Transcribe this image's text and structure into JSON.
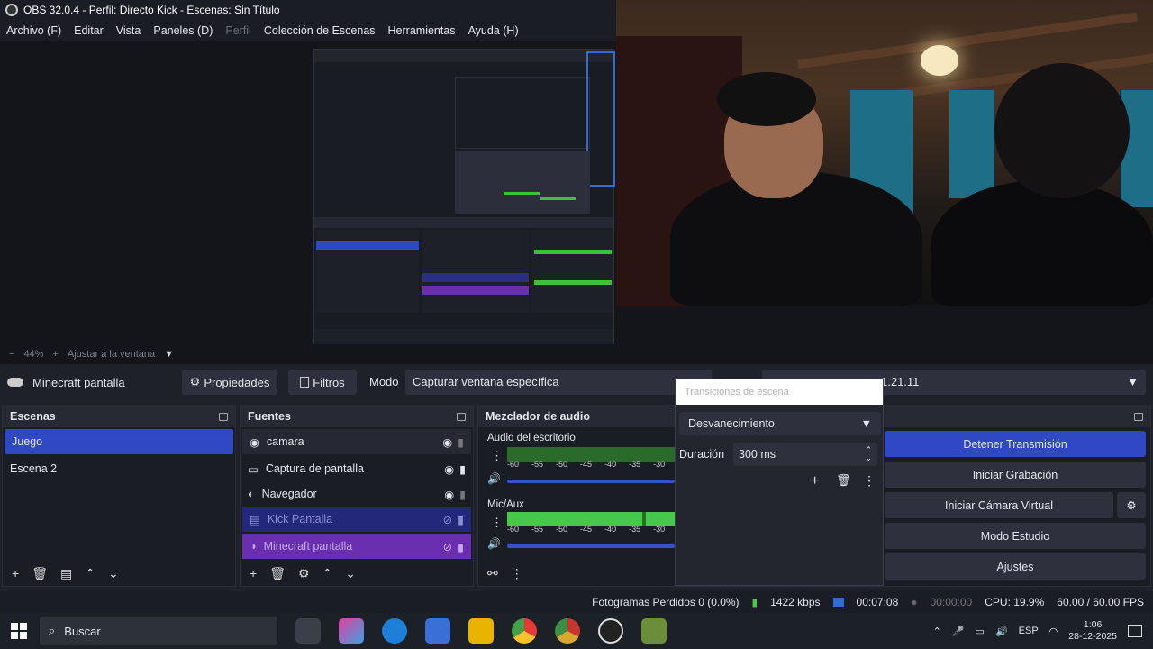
{
  "window": {
    "title": "OBS 32.0.4 - Perfil: Directo Kick - Escenas: Sin Título"
  },
  "menu": {
    "items": [
      "Archivo (F)",
      "Editar",
      "Vista",
      "Paneles (D)",
      "Perfil",
      "Colección de Escenas",
      "Herramientas",
      "Ayuda (H)"
    ]
  },
  "zoom": {
    "minus": "−",
    "value": "44%",
    "plus": "+",
    "fit": "Ajustar a la ventana"
  },
  "source_bar": {
    "name": "Minecraft pantalla",
    "properties": "Propiedades",
    "filters": "Filtros",
    "mode_label": "Modo",
    "mode_value": "Capturar ventana específica",
    "window_suffix": "1.21.11"
  },
  "scenes": {
    "title": "Escenas",
    "items": [
      "Juego",
      "Escena 2"
    ]
  },
  "sources": {
    "title": "Fuentes",
    "items": [
      "camara",
      "Captura de pantalla",
      "Navegador",
      "Kick Pantalla",
      "Minecraft pantalla"
    ]
  },
  "mixer": {
    "title": "Mezclador de audio",
    "channels": [
      "Audio del escritorio",
      "Mic/Aux"
    ],
    "ticks": [
      "-60",
      "-55",
      "-50",
      "-45",
      "-40",
      "-35",
      "-30"
    ]
  },
  "transitions": {
    "title": "Transiciones de escena",
    "type": "Desvanecimiento",
    "duration_label": "Duración",
    "duration_value": "300 ms"
  },
  "controls": {
    "stream": "Detener Transmisión",
    "record": "Iniciar Grabación",
    "virtualcam": "Iniciar Cámara Virtual",
    "studio": "Modo Estudio",
    "settings": "Ajustes"
  },
  "status": {
    "dropped": "Fotogramas Perdidos 0 (0.0%)",
    "bitrate": "1422 kbps",
    "stream_time": "00:07:08",
    "rec_time": "00:00:00",
    "cpu": "CPU: 19.9%",
    "fps": "60.00 / 60.00 FPS"
  },
  "taskbar": {
    "search": "Buscar",
    "lang": "ESP",
    "time": "1:06",
    "date": "28-12-2025"
  },
  "colors": {
    "accent": "#2f49c4",
    "selected_scene": "#2f49c4",
    "meter_green": "#46c94b",
    "purple": "#6a2fb0"
  }
}
